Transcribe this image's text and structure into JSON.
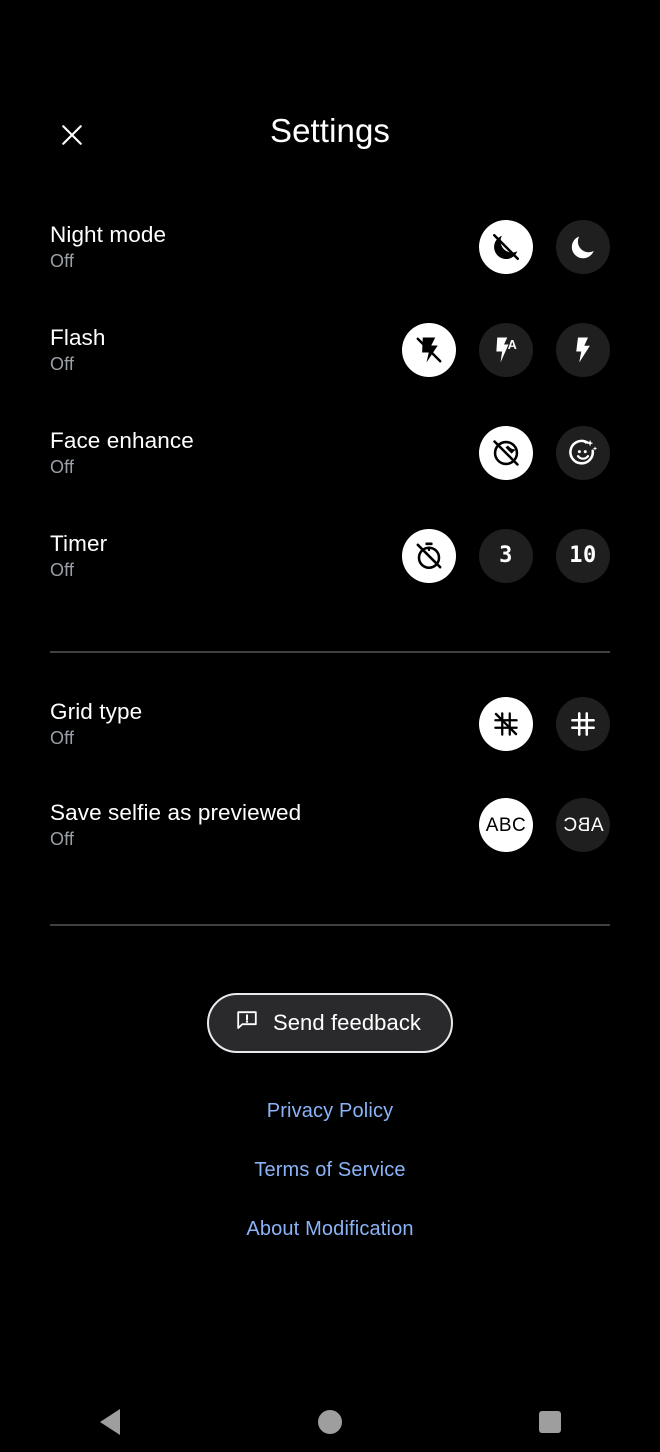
{
  "header": {
    "title": "Settings",
    "close_icon": "close-icon"
  },
  "settings": {
    "group_1": [
      {
        "key": "night_mode",
        "label": "Night mode",
        "value": "Off",
        "options": [
          {
            "id": "night-off",
            "icon": "moon-off-icon",
            "selected": true
          },
          {
            "id": "night-on",
            "icon": "moon-icon",
            "selected": false
          }
        ]
      },
      {
        "key": "flash",
        "label": "Flash",
        "value": "Off",
        "options": [
          {
            "id": "flash-off",
            "icon": "flash-off-icon",
            "selected": true
          },
          {
            "id": "flash-auto",
            "icon": "flash-auto-icon",
            "selected": false
          },
          {
            "id": "flash-on",
            "icon": "flash-on-icon",
            "selected": false
          }
        ]
      },
      {
        "key": "face_enhance",
        "label": "Face enhance",
        "value": "Off",
        "options": [
          {
            "id": "face-off",
            "icon": "face-retouch-off-icon",
            "selected": true
          },
          {
            "id": "face-on",
            "icon": "face-retouch-on-icon",
            "selected": false
          }
        ]
      },
      {
        "key": "timer",
        "label": "Timer",
        "value": "Off",
        "options": [
          {
            "id": "timer-off",
            "icon": "timer-off-icon",
            "selected": true
          },
          {
            "id": "timer-3",
            "text": "3",
            "selected": false
          },
          {
            "id": "timer-10",
            "text": "10",
            "selected": false
          }
        ]
      }
    ],
    "group_2": [
      {
        "key": "grid_type",
        "label": "Grid type",
        "value": "Off",
        "options": [
          {
            "id": "grid-off",
            "icon": "grid-off-icon",
            "selected": true
          },
          {
            "id": "grid-on",
            "icon": "grid-on-icon",
            "selected": false
          }
        ]
      },
      {
        "key": "save_selfie_as_previewed",
        "label": "Save selfie as previewed",
        "value": "Off",
        "options": [
          {
            "id": "selfie-normal",
            "text": "ABC",
            "mirrored": false,
            "selected": true
          },
          {
            "id": "selfie-mirrored",
            "text": "ABC",
            "mirrored": true,
            "selected": false
          }
        ]
      }
    ]
  },
  "footer": {
    "feedback_label": "Send feedback",
    "feedback_icon": "feedback-icon",
    "links": [
      {
        "id": "privacy-policy",
        "label": "Privacy Policy"
      },
      {
        "id": "terms-of-service",
        "label": "Terms of Service"
      },
      {
        "id": "about-modification",
        "label": "About Modification"
      }
    ]
  },
  "navbar": {
    "back": "back-icon",
    "home": "home-icon",
    "recents": "recents-icon"
  },
  "colors": {
    "background": "#000000",
    "selected_bg": "#ffffff",
    "unselected_bg": "#1f1f1f",
    "secondary_text": "#9aa0a6",
    "link": "#8ab4f8",
    "divider": "#3c4043",
    "nav_icon": "#9e9e9e"
  }
}
